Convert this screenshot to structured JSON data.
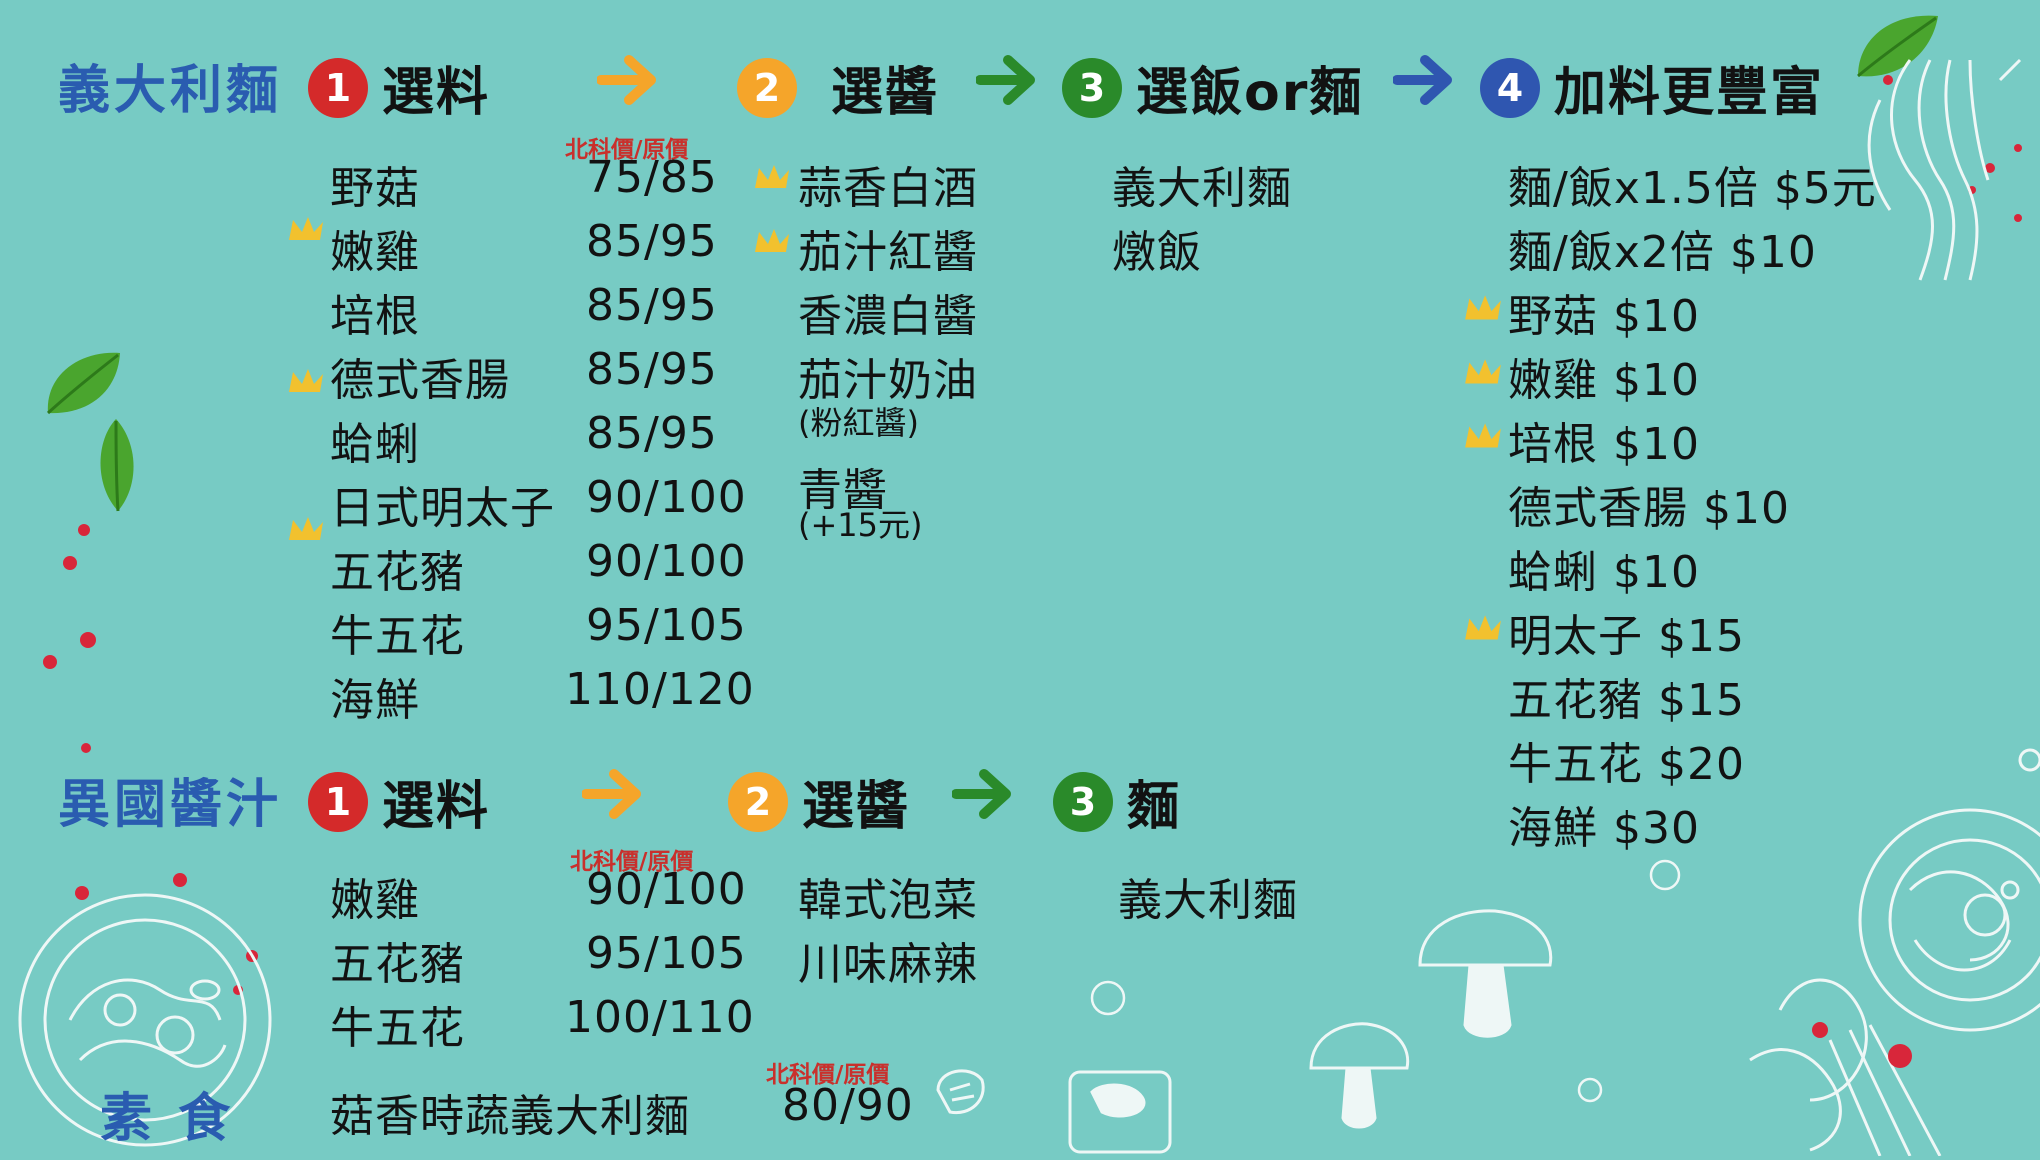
{
  "colors": {
    "background": "#77cbc4",
    "title_blue": "#2a5cb0",
    "step1_red": "#d42a2a",
    "step2_orange": "#f5a52a",
    "step3_green": "#2a8a2a",
    "step4_blue": "#2f56b0",
    "arrow_orange": "#f5a52a",
    "arrow_green": "#2a8a2a",
    "arrow_blue": "#2f56b0",
    "crown_yellow": "#f2c12e",
    "price_label_red": "#c9302c"
  },
  "pasta": {
    "title": "義大利麵",
    "step1": {
      "num": "1",
      "label": "選料"
    },
    "step2": {
      "num": "2",
      "label": "選醬"
    },
    "step3": {
      "num": "3",
      "label": "選飯or麵"
    },
    "step4": {
      "num": "4",
      "label": "加料更豐富"
    },
    "price_label": "北科價/原價",
    "ingredients": [
      {
        "name": "野菇",
        "price": "75/85",
        "crown": false
      },
      {
        "name": "嫩雞",
        "price": "85/95",
        "crown": true
      },
      {
        "name": "培根",
        "price": "85/95",
        "crown": false
      },
      {
        "name": "德式香腸",
        "price": "85/95",
        "crown": true
      },
      {
        "name": "蛤蜊",
        "price": "85/95",
        "crown": false
      },
      {
        "name": "日式明太子",
        "price": "90/100",
        "crown": false
      },
      {
        "name": "五花豬",
        "price": "90/100",
        "crown": true
      },
      {
        "name": "牛五花",
        "price": "95/105",
        "crown": false
      },
      {
        "name": "海鮮",
        "price": "110/120",
        "crown": false
      }
    ],
    "sauces": [
      {
        "name": "蒜香白酒",
        "crown": true
      },
      {
        "name": "茄汁紅醬",
        "crown": true
      },
      {
        "name": "香濃白醬",
        "crown": false
      },
      {
        "name": "茄汁奶油",
        "note": "(粉紅醬)",
        "crown": false
      },
      {
        "name": "青醬",
        "note": "(+15元)",
        "crown": false
      }
    ],
    "bases": [
      "義大利麵",
      "燉飯"
    ],
    "addons": [
      {
        "text": "麵/飯x1.5倍  $5元",
        "crown": false
      },
      {
        "text": "麵/飯x2倍  $10",
        "crown": false
      },
      {
        "text": "野菇  $10",
        "crown": true
      },
      {
        "text": "嫩雞  $10",
        "crown": true
      },
      {
        "text": "培根  $10",
        "crown": true
      },
      {
        "text": "德式香腸  $10",
        "crown": false
      },
      {
        "text": "蛤蜊  $10",
        "crown": false
      },
      {
        "text": "明太子  $15",
        "crown": true
      },
      {
        "text": "五花豬  $15",
        "crown": false
      },
      {
        "text": "牛五花  $20",
        "crown": false
      },
      {
        "text": "海鮮  $30",
        "crown": false
      }
    ]
  },
  "exotic": {
    "title": "異國醬汁",
    "step1": {
      "num": "1",
      "label": "選料"
    },
    "step2": {
      "num": "2",
      "label": "選醬"
    },
    "step3": {
      "num": "3",
      "label": "麵"
    },
    "price_label": "北科價/原價",
    "ingredients": [
      {
        "name": "嫩雞",
        "price": "90/100"
      },
      {
        "name": "五花豬",
        "price": "95/105"
      },
      {
        "name": "牛五花",
        "price": "100/110"
      }
    ],
    "sauces": [
      "韓式泡菜",
      "川味麻辣"
    ],
    "bases": [
      "義大利麵"
    ]
  },
  "veg": {
    "title": "素  食",
    "item": "菇香時蔬義大利麵",
    "price_label": "北科價/原價",
    "price": "80/90"
  }
}
